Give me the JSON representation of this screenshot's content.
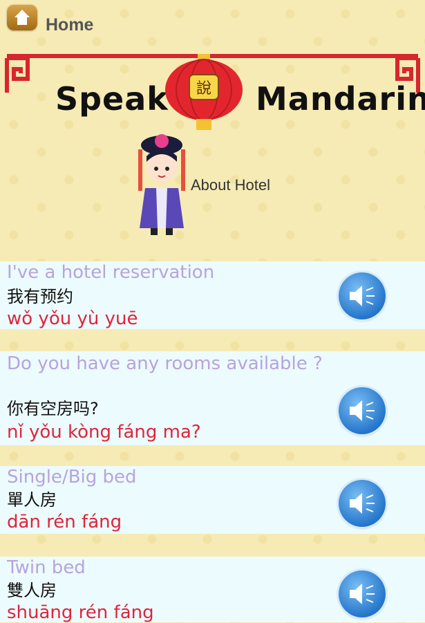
{
  "topbar": {
    "home_label": "Home"
  },
  "banner": {
    "brand_left": "Speak",
    "brand_right": "Mandarin",
    "lantern_text": "說"
  },
  "section": {
    "title": "About Hotel"
  },
  "phrases": [
    {
      "english": "I've a hotel reservation",
      "chinese": "我有预约",
      "pinyin": "wǒ yǒu yù yuē"
    },
    {
      "english": "Do you have any rooms available ?",
      "chinese": "你有空房吗?",
      "pinyin": "nǐ yǒu kòng fáng ma?"
    },
    {
      "english": "Single/Big bed",
      "chinese": " 單人房",
      "pinyin": "dān rén fáng"
    },
    {
      "english": "Twin bed",
      "chinese": "雙人房",
      "pinyin": "shuāng rén fáng"
    }
  ],
  "colors": {
    "background": "#f6ebb5",
    "card": "#ecfbfd",
    "english_text": "#b8a3dd",
    "pinyin_text": "#e0243b",
    "speaker": "#2677cc"
  },
  "icons": {
    "home": "home-icon",
    "speaker": "speaker-icon"
  }
}
